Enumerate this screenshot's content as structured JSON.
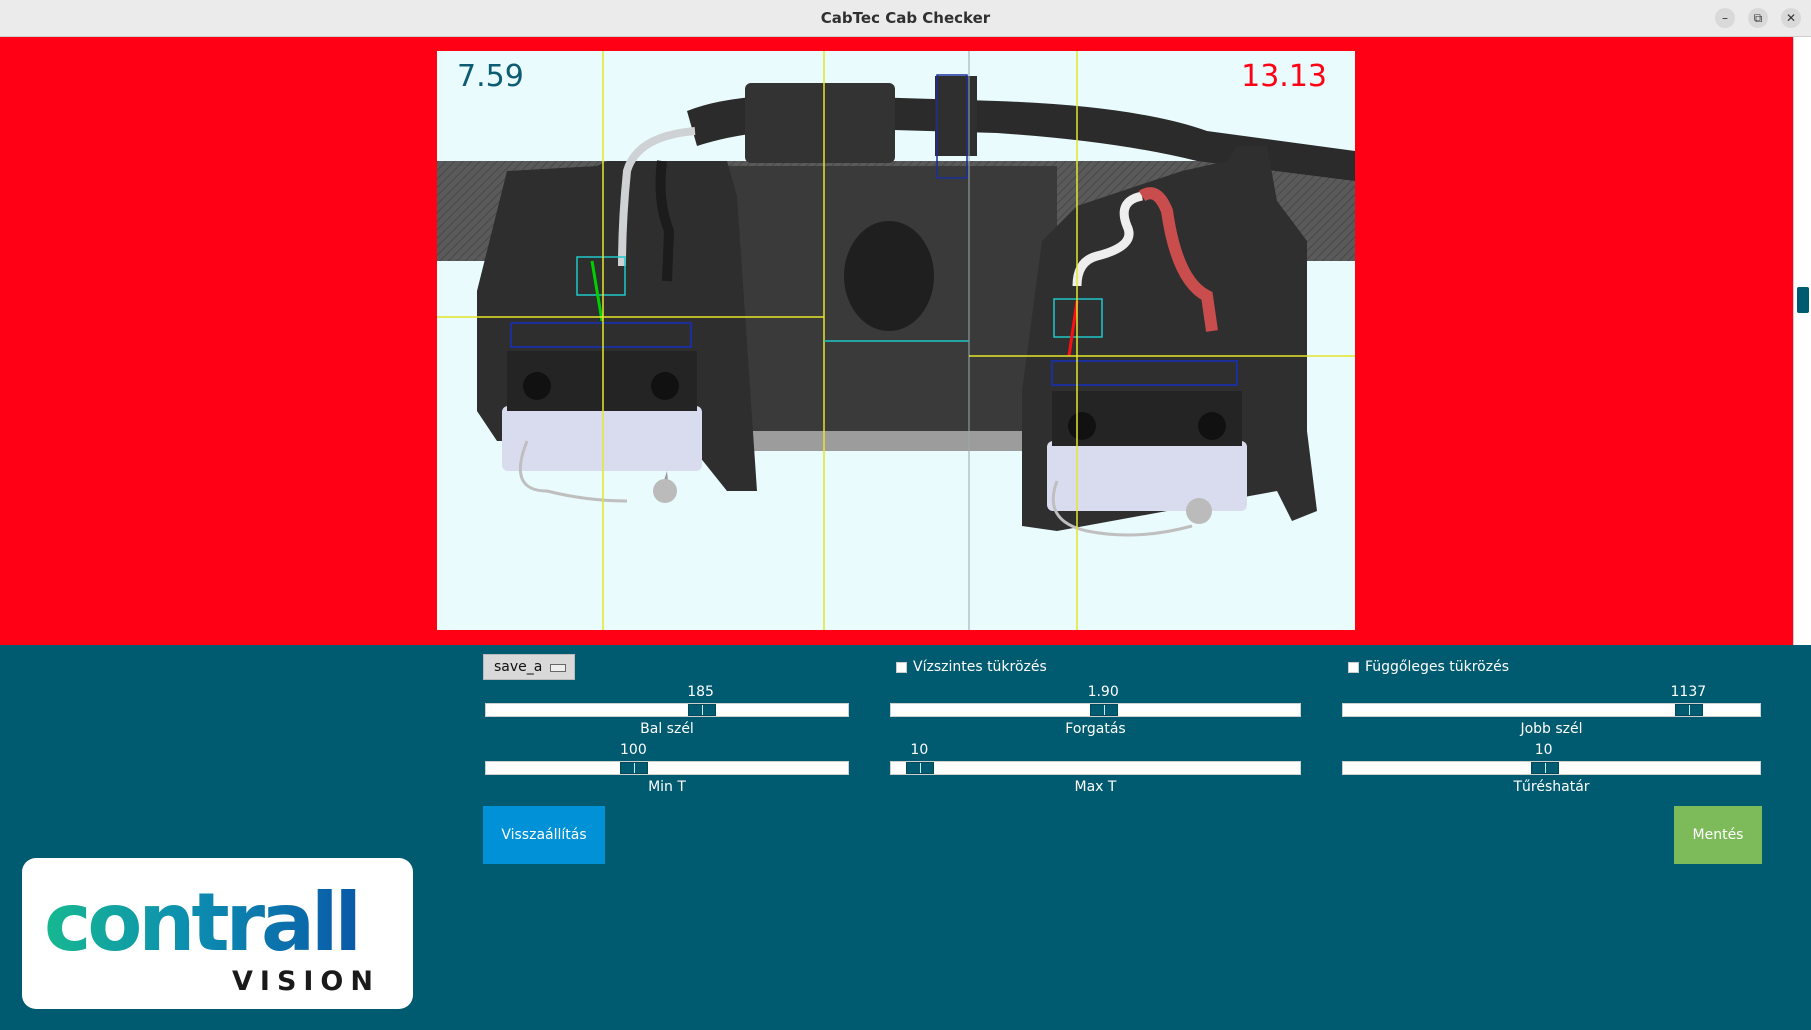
{
  "window": {
    "title": "CabTec Cab Checker"
  },
  "window_controls": {
    "minimize": "–",
    "maximize": "⧉",
    "close": "✕"
  },
  "camera": {
    "left_measure": "7.59",
    "right_measure": "13.13"
  },
  "colors": {
    "status_fail": "#ff0015",
    "panel_bg": "#005a70",
    "reset_button": "#0091d6",
    "save_button": "#7dba5a"
  },
  "controls": {
    "profile_select": {
      "value": "save_a"
    },
    "horizontal_mirror": {
      "label": "Vízszintes tükrözés",
      "checked": false
    },
    "vertical_mirror": {
      "label": "Függőleges tükrözés",
      "checked": false
    },
    "sliders": {
      "left_edge": {
        "label": "Bal szél",
        "value": "185",
        "fraction": 0.6
      },
      "rotation": {
        "label": "Forgatás",
        "value": "1.90",
        "fraction": 0.52
      },
      "right_edge": {
        "label": "Jobb szél",
        "value": "1137",
        "fraction": 0.85
      },
      "min_t": {
        "label": "Min T",
        "value": "100",
        "fraction": 0.4
      },
      "max_t": {
        "label": "Max T",
        "value": "10",
        "fraction": 0.04
      },
      "tolerance": {
        "label": "Tűréshatár",
        "value": "10",
        "fraction": 0.48
      }
    },
    "reset_button": "Visszaállítás",
    "save_button": "Mentés"
  },
  "logo": {
    "word": "contrall",
    "sub": "VISION"
  }
}
